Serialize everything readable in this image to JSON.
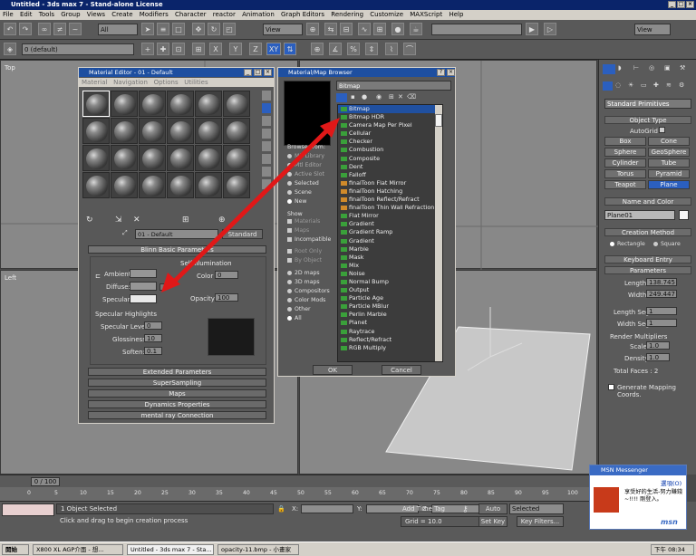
{
  "app": {
    "title": "Untitled - 3ds max 7 - Stand-alone License"
  },
  "menu": [
    "File",
    "Edit",
    "Tools",
    "Group",
    "Views",
    "Create",
    "Modifiers",
    "Character",
    "reactor",
    "Animation",
    "Graph Editors",
    "Rendering",
    "Customize",
    "MAXScript",
    "Help"
  ],
  "toolbar": {
    "selection_filter": "All",
    "ref_coord": "View",
    "axes": [
      "X",
      "Y",
      "Z",
      "XY"
    ],
    "named_sel": "View",
    "layer": "0 (default)"
  },
  "viewports": {
    "top": "Top",
    "left": "Left"
  },
  "material_editor": {
    "title": "Material Editor - 01 - Default",
    "menu": [
      "Material",
      "Navigation",
      "Options",
      "Utilities"
    ],
    "mat_name": "01 - Default",
    "mat_type": "Standard",
    "rollout_basic": "Blinn Basic Parameters",
    "self_illum": "Self-Illumination",
    "ambient": "Ambient:",
    "diffuse": "Diffuse:",
    "specular": "Specular:",
    "color_label": "Color",
    "color_val": "0",
    "opacity_label": "Opacity:",
    "opacity_val": "100",
    "spec_highlights": "Specular Highlights",
    "spec_level_label": "Specular Level:",
    "spec_level_val": "0",
    "gloss_label": "Glossiness:",
    "gloss_val": "10",
    "soften_label": "Soften:",
    "soften_val": "0.1",
    "rollouts": [
      "Extended Parameters",
      "SuperSampling",
      "Maps",
      "Dynamics Properties",
      "mental ray Connection"
    ]
  },
  "browser": {
    "title": "Material/Map Browser",
    "name_field": "Bitmap",
    "browse_from": "Browse From:",
    "browse_options": [
      "Mtl Library",
      "Mtl Editor",
      "Active Slot",
      "Selected",
      "Scene",
      "New"
    ],
    "show": "Show",
    "show_options": [
      "Materials",
      "Maps",
      "Incompatible"
    ],
    "root_only": "Root Only",
    "by_object": "By Object",
    "map_types": [
      "2D maps",
      "3D maps",
      "Compositors",
      "Color Mods",
      "Other",
      "All"
    ],
    "items": [
      "Bitmap",
      "Bitmap HDR",
      "Camera Map Per Pixel",
      "Cellular",
      "Checker",
      "Combustion",
      "Composite",
      "Dent",
      "Falloff",
      "finalToon Flat Mirror",
      "finalToon Hatching",
      "finalToon Reflect/Refract",
      "finalToon Thin Wall Refraction",
      "Flat Mirror",
      "Gradient",
      "Gradient Ramp",
      "Gradient",
      "Marble",
      "Mask",
      "Mix",
      "Noise",
      "Normal Bump",
      "Output",
      "Particle Age",
      "Particle MBlur",
      "Perlin Marble",
      "Planet",
      "Raytrace",
      "Reflect/Refract",
      "RGB Multiply"
    ],
    "ok": "OK",
    "cancel": "Cancel"
  },
  "command_panel": {
    "category": "Standard Primitives",
    "object_type": "Object Type",
    "autogrid": "AutoGrid",
    "buttons": [
      "Box",
      "Cone",
      "Sphere",
      "GeoSphere",
      "Cylinder",
      "Tube",
      "Torus",
      "Pyramid",
      "Teapot",
      "Plane"
    ],
    "name_color": "Name and Color",
    "object_name": "Plane01",
    "creation_method": "Creation Method",
    "rectangle": "Rectangle",
    "square": "Square",
    "keyboard_entry": "Keyboard Entry",
    "parameters": "Parameters",
    "length_label": "Length:",
    "length_val": "138.745",
    "width_label": "Width:",
    "width_val": "249.447",
    "length_segs_label": "Length Segs:",
    "length_segs_val": "1",
    "width_segs_label": "Width Segs:",
    "width_segs_val": "1",
    "render_mult": "Render Multipliers",
    "scale_label": "Scale:",
    "scale_val": "1.0",
    "density_label": "Density:",
    "density_val": "1.0",
    "total_faces": "Total Faces : 2",
    "gen_mapping": "Generate Mapping Coords."
  },
  "timeline": {
    "frame": "0 / 100",
    "ticks": [
      "0",
      "5",
      "10",
      "15",
      "20",
      "25",
      "30",
      "35",
      "40",
      "45",
      "50",
      "55",
      "60",
      "65",
      "70",
      "75",
      "80",
      "85",
      "90",
      "95",
      "100"
    ]
  },
  "status": {
    "selected": "1 Object Selected",
    "prompt": "Click and drag to begin creation process",
    "x_label": "X:",
    "y_label": "Y:",
    "z_label": "Z:",
    "grid": "Grid = 10.0",
    "auto_key": "Auto Key",
    "selected_combo": "Selected",
    "set_key": "Set Key",
    "key_filters": "Key Filters...",
    "add_time_tag": "Add Time Tag"
  },
  "msn": {
    "title": "MSN Messenger",
    "link": "選項(O)",
    "text": "享受好的生活-努力賺錢~!!!! 剛登入。",
    "brand": "msn"
  },
  "taskbar": {
    "start": "開始",
    "tasks": [
      "X800 XL AGP介面 - 想...",
      "Untitled - 3ds max 7 - Sta...",
      "opacity-11.bmp - 小畫家"
    ],
    "clock": "下午 08:34"
  },
  "colors": {
    "accent_red": "#e01818",
    "selection_blue": "#2050a0"
  }
}
